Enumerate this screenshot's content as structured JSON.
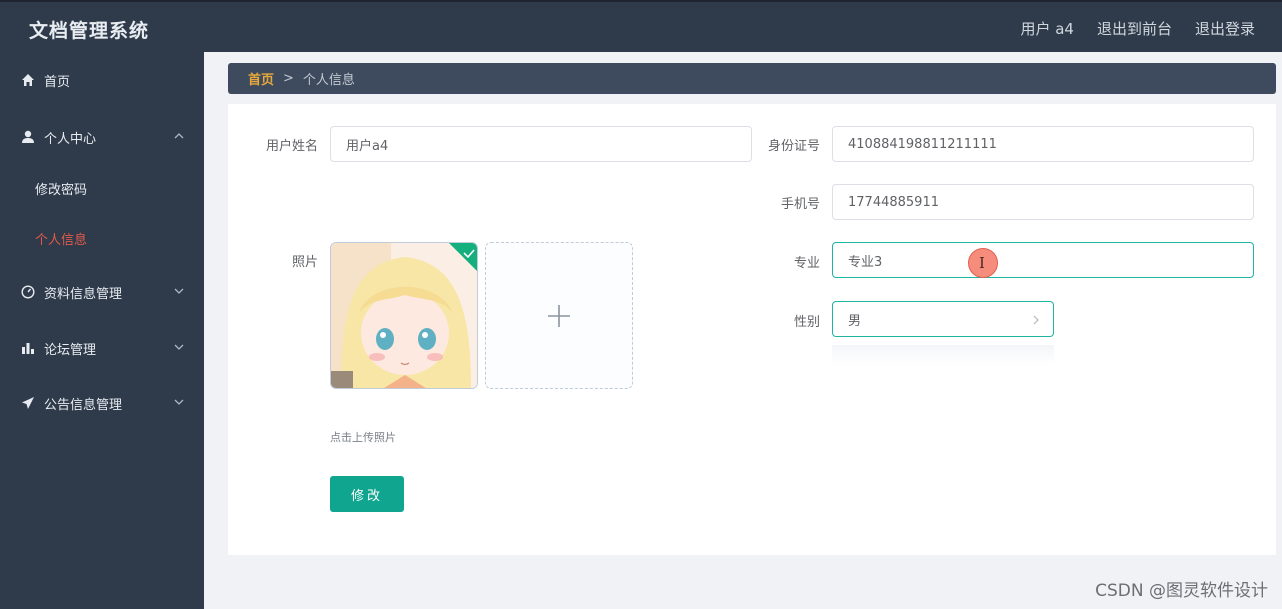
{
  "app": {
    "title": "文档管理系统"
  },
  "header": {
    "user_label": "用户 a4",
    "back_to_front": "退出到前台",
    "logout": "退出登录"
  },
  "sidebar": {
    "items": [
      {
        "label": "首页",
        "icon": "home-icon"
      },
      {
        "label": "个人中心",
        "icon": "user-icon",
        "expanded": true,
        "children": [
          {
            "label": "修改密码"
          },
          {
            "label": "个人信息",
            "active": true
          }
        ]
      },
      {
        "label": "资料信息管理",
        "icon": "gauge-icon"
      },
      {
        "label": "论坛管理",
        "icon": "bar-chart-icon"
      },
      {
        "label": "公告信息管理",
        "icon": "paper-plane-icon"
      }
    ]
  },
  "breadcrumb": {
    "home": "首页",
    "separator": ">",
    "current": "个人信息"
  },
  "form": {
    "name_label": "用户姓名",
    "name_value": "用户a4",
    "id_label": "身份证号",
    "id_value": "410884198811211111",
    "phone_label": "手机号",
    "phone_value": "17744885911",
    "major_label": "专业",
    "major_value": "专业3",
    "gender_label": "性别",
    "gender_value": "男",
    "photo_label": "照片",
    "upload_tip": "点击上传照片",
    "submit_label": "修改"
  },
  "watermark": "CSDN @图灵软件设计",
  "colors": {
    "sidebar_bg": "#2f3b4b",
    "accent": "#10a58e",
    "active_menu": "#e25a4b",
    "breadcrumb_home": "#e8a93a"
  }
}
